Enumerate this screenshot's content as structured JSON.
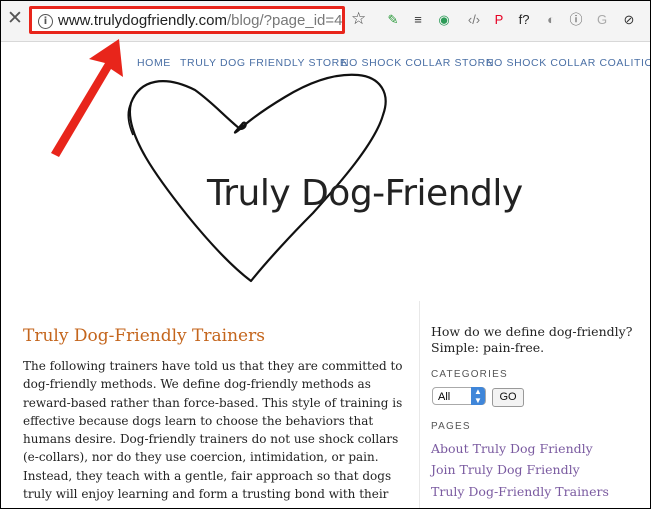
{
  "browser": {
    "url_domain": "www.trulydogfriendly.com",
    "url_path": "/blog/?page_id=4",
    "info_glyph": "i",
    "close_glyph": "✕",
    "star_glyph": "☆",
    "extensions": [
      {
        "name": "tag-extension-icon",
        "glyph": "✎",
        "color": "#2b9a3b"
      },
      {
        "name": "buffer-icon",
        "glyph": "≡",
        "color": "#333333"
      },
      {
        "name": "new-badge-extension-icon",
        "glyph": "◉",
        "color": "#2d9c58"
      },
      {
        "name": "code-icon",
        "glyph": "‹/›",
        "color": "#777777"
      },
      {
        "name": "pinterest-icon",
        "glyph": "P",
        "color": "#e60023"
      },
      {
        "name": "function-icon",
        "glyph": "f?",
        "color": "#222222"
      },
      {
        "name": "moon-icon",
        "glyph": "◐",
        "color": "#888888"
      },
      {
        "name": "info-circle-icon",
        "glyph": "ⓘ",
        "color": "#444444"
      },
      {
        "name": "grammarly-icon",
        "glyph": "G",
        "color": "#aaaaaa"
      },
      {
        "name": "no-sign-icon",
        "glyph": "⊘",
        "color": "#333333"
      }
    ]
  },
  "nav": {
    "items": [
      "HOME",
      "TRULY DOG FRIENDLY STORE",
      "NO SHOCK COLLAR STORE",
      "NO SHOCK COLLAR COALITION"
    ]
  },
  "logo": {
    "text": "Truly  Dog-Friendly"
  },
  "main": {
    "title": "Truly Dog-Friendly Trainers",
    "body": "The following trainers have told us that they are committed to dog-friendly methods. We define dog-friendly methods as reward-based rather than force-based. This style of training is effective because dogs learn to choose the behaviors that humans desire. Dog-friendly trainers do not use shock collars (e-collars), nor do they use coercion, intimidation, or pain. Instead, they teach with a gentle, fair approach so that dogs truly will enjoy learning and form a trusting bond with their owners."
  },
  "sidebar": {
    "tagline": "How do we define dog-friendly? Simple: pain-free.",
    "categories_heading": "CATEGORIES",
    "categories_selected": "All",
    "go_label": "GO",
    "pages_heading": "PAGES",
    "pages": [
      "About Truly Dog Friendly",
      "Join Truly Dog Friendly",
      "Truly Dog-Friendly Trainers"
    ]
  },
  "colors": {
    "annotation_red": "#e8251b",
    "title_orange": "#c4651c",
    "link_purple": "#7a5aa0",
    "nav_blue": "#4a6fa5"
  }
}
